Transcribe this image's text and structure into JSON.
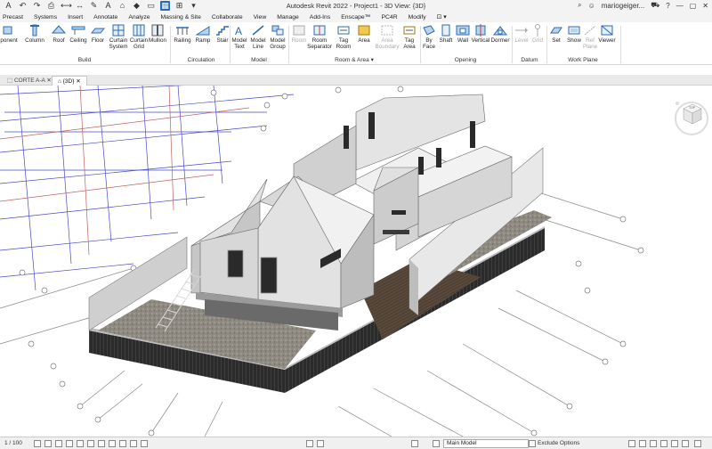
{
  "window": {
    "title": "Autodesk Revit 2022 - Project1 - 3D View: {3D}",
    "user": "mariogeiger..."
  },
  "menu": [
    {
      "label": "Precast"
    },
    {
      "label": "Systems"
    },
    {
      "label": "Insert"
    },
    {
      "label": "Annotate"
    },
    {
      "label": "Analyze"
    },
    {
      "label": "Massing & Site"
    },
    {
      "label": "Collaborate"
    },
    {
      "label": "View"
    },
    {
      "label": "Manage"
    },
    {
      "label": "Add-Ins"
    },
    {
      "label": "Enscape™"
    },
    {
      "label": "PC4R"
    },
    {
      "label": "Modify"
    }
  ],
  "ribbon": {
    "buttons": [
      {
        "label": "ponent",
        "icon": "component-icon"
      },
      {
        "label": "Column",
        "icon": "column-icon"
      },
      {
        "label": "Roof",
        "icon": "roof-icon"
      },
      {
        "label": "Ceiling",
        "icon": "ceiling-icon"
      },
      {
        "label": "Floor",
        "icon": "floor-icon"
      },
      {
        "label": "Curtain System",
        "icon": "curtain-system-icon"
      },
      {
        "label": "Curtain Grid",
        "icon": "curtain-grid-icon"
      },
      {
        "label": "Mullion",
        "icon": "mullion-icon"
      },
      {
        "label": "Railing",
        "icon": "railing-icon"
      },
      {
        "label": "Ramp",
        "icon": "ramp-icon"
      },
      {
        "label": "Stair",
        "icon": "stair-icon"
      },
      {
        "label": "Model Text",
        "icon": "model-text-icon"
      },
      {
        "label": "Model Line",
        "icon": "model-line-icon"
      },
      {
        "label": "Model Group",
        "icon": "model-group-icon"
      },
      {
        "label": "Room",
        "icon": "room-icon",
        "dim": true
      },
      {
        "label": "Room Separator",
        "icon": "room-separator-icon"
      },
      {
        "label": "Tag Room",
        "icon": "tag-room-icon"
      },
      {
        "label": "Area",
        "icon": "area-icon"
      },
      {
        "label": "Area Boundary",
        "icon": "area-boundary-icon",
        "dim": true
      },
      {
        "label": "Tag Area",
        "icon": "tag-area-icon"
      },
      {
        "label": "By Face",
        "icon": "by-face-icon"
      },
      {
        "label": "Shaft",
        "icon": "shaft-icon"
      },
      {
        "label": "Wall",
        "icon": "wall-opening-icon"
      },
      {
        "label": "Vertical",
        "icon": "vertical-icon"
      },
      {
        "label": "Dormer",
        "icon": "dormer-icon"
      },
      {
        "label": "Level",
        "icon": "level-icon",
        "dim": true
      },
      {
        "label": "Grid",
        "icon": "grid-icon",
        "dim": true
      },
      {
        "label": "Set",
        "icon": "set-icon"
      },
      {
        "label": "Show",
        "icon": "show-icon"
      },
      {
        "label": "Ref Plane",
        "icon": "ref-plane-icon",
        "dim": true
      },
      {
        "label": "Viewer",
        "icon": "viewer-icon"
      }
    ],
    "panels": [
      {
        "label": "Build"
      },
      {
        "label": "Circulation"
      },
      {
        "label": "Model"
      },
      {
        "label": "Room & Area ▾"
      },
      {
        "label": "Opening"
      },
      {
        "label": "Datum"
      },
      {
        "label": "Work Plane"
      }
    ]
  },
  "tabs": [
    {
      "label": "CORTE A-A"
    },
    {
      "label": "{3D}",
      "active": true
    }
  ],
  "status": {
    "scale": "1 / 100",
    "model": "Main Model",
    "exclude": "Exclude Options"
  },
  "colors": {
    "accent": "#2b6cb0",
    "grid_blue": "#3b3bd0",
    "grid_red": "#c04040",
    "cladding": "#2a2a2a",
    "wall": "#d9d9d9"
  }
}
